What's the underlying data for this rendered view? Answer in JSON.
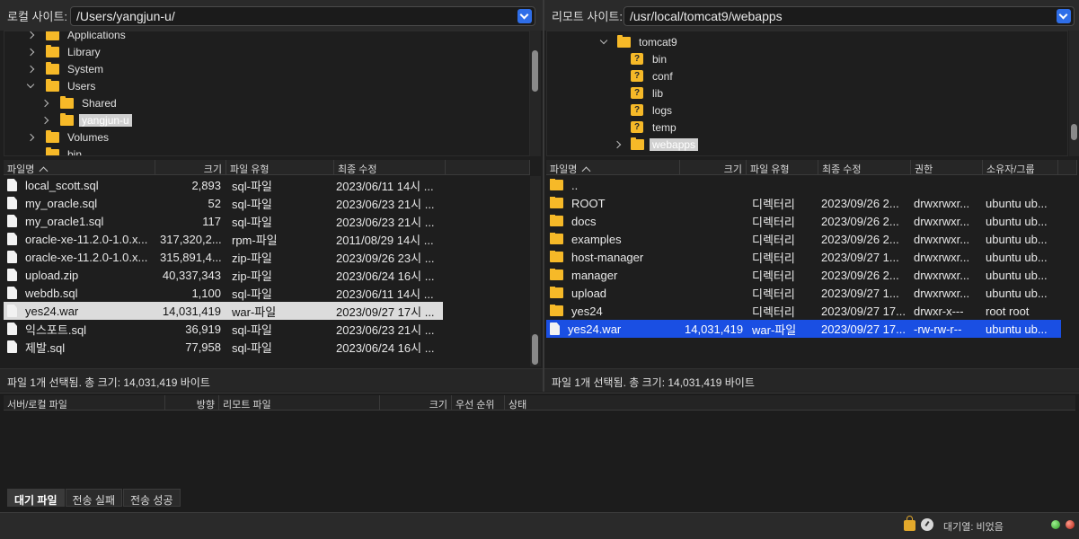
{
  "local": {
    "site_label": "로컬 사이트:",
    "path": "/Users/yangjun-u/",
    "tree": [
      {
        "label": "Applications",
        "depth": 0,
        "expand": "right"
      },
      {
        "label": "Library",
        "depth": 0,
        "expand": "right"
      },
      {
        "label": "System",
        "depth": 0,
        "expand": "right"
      },
      {
        "label": "Users",
        "depth": 0,
        "expand": "down"
      },
      {
        "label": "Shared",
        "depth": 1,
        "expand": "right"
      },
      {
        "label": "yangjun-u",
        "depth": 1,
        "expand": "right",
        "selected": true
      },
      {
        "label": "Volumes",
        "depth": 0,
        "expand": "right"
      },
      {
        "label": "bin",
        "depth": 0,
        "expand": "none"
      }
    ],
    "columns": {
      "name": "파일명",
      "size": "크기",
      "type": "파일 유형",
      "modified": "최종 수정"
    },
    "files": [
      {
        "name": "local_scott.sql",
        "size": "2,893",
        "type": "sql-파일",
        "modified": "2023/06/11 14시 ..."
      },
      {
        "name": "my_oracle.sql",
        "size": "52",
        "type": "sql-파일",
        "modified": "2023/06/23 21시 ..."
      },
      {
        "name": "my_oracle1.sql",
        "size": "117",
        "type": "sql-파일",
        "modified": "2023/06/23 21시 ..."
      },
      {
        "name": "oracle-xe-11.2.0-1.0.x...",
        "size": "317,320,2...",
        "type": "rpm-파일",
        "modified": "2011/08/29 14시 ..."
      },
      {
        "name": "oracle-xe-11.2.0-1.0.x...",
        "size": "315,891,4...",
        "type": "zip-파일",
        "modified": "2023/09/26 23시 ..."
      },
      {
        "name": "upload.zip",
        "size": "40,337,343",
        "type": "zip-파일",
        "modified": "2023/06/24 16시 ..."
      },
      {
        "name": "webdb.sql",
        "size": "1,100",
        "type": "sql-파일",
        "modified": "2023/06/11 14시 ..."
      },
      {
        "name": "yes24.war",
        "size": "14,031,419",
        "type": "war-파일",
        "modified": "2023/09/27 17시 ...",
        "selected": true
      },
      {
        "name": "익스포트.sql",
        "size": "36,919",
        "type": "sql-파일",
        "modified": "2023/06/23 21시 ..."
      },
      {
        "name": "제발.sql",
        "size": "77,958",
        "type": "sql-파일",
        "modified": "2023/06/24 16시 ..."
      }
    ],
    "status": "파일 1개 선택됨. 총 크기: 14,031,419 바이트"
  },
  "remote": {
    "site_label": "리모트 사이트:",
    "path": "/usr/local/tomcat9/webapps",
    "tree": [
      {
        "label": "tomcat9",
        "depth": 0,
        "expand": "down",
        "icon": "folder"
      },
      {
        "label": "bin",
        "depth": 1,
        "expand": "none",
        "icon": "unknown"
      },
      {
        "label": "conf",
        "depth": 1,
        "expand": "none",
        "icon": "unknown"
      },
      {
        "label": "lib",
        "depth": 1,
        "expand": "none",
        "icon": "unknown"
      },
      {
        "label": "logs",
        "depth": 1,
        "expand": "none",
        "icon": "unknown"
      },
      {
        "label": "temp",
        "depth": 1,
        "expand": "none",
        "icon": "unknown"
      },
      {
        "label": "webapps",
        "depth": 1,
        "expand": "right",
        "icon": "folder",
        "selected": true
      }
    ],
    "columns": {
      "name": "파일명",
      "size": "크기",
      "type": "파일 유형",
      "modified": "최종 수정",
      "perms": "권한",
      "owner": "소유자/그룹"
    },
    "files": [
      {
        "name": "..",
        "size": "",
        "type": "",
        "modified": "",
        "perms": "",
        "owner": "",
        "kind": "folder"
      },
      {
        "name": "ROOT",
        "size": "",
        "type": "디렉터리",
        "modified": "2023/09/26 2...",
        "perms": "drwxrwxr...",
        "owner": "ubuntu ub...",
        "kind": "folder"
      },
      {
        "name": "docs",
        "size": "",
        "type": "디렉터리",
        "modified": "2023/09/26 2...",
        "perms": "drwxrwxr...",
        "owner": "ubuntu ub...",
        "kind": "folder"
      },
      {
        "name": "examples",
        "size": "",
        "type": "디렉터리",
        "modified": "2023/09/26 2...",
        "perms": "drwxrwxr...",
        "owner": "ubuntu ub...",
        "kind": "folder"
      },
      {
        "name": "host-manager",
        "size": "",
        "type": "디렉터리",
        "modified": "2023/09/27 1...",
        "perms": "drwxrwxr...",
        "owner": "ubuntu ub...",
        "kind": "folder"
      },
      {
        "name": "manager",
        "size": "",
        "type": "디렉터리",
        "modified": "2023/09/26 2...",
        "perms": "drwxrwxr...",
        "owner": "ubuntu ub...",
        "kind": "folder"
      },
      {
        "name": "upload",
        "size": "",
        "type": "디렉터리",
        "modified": "2023/09/27 1...",
        "perms": "drwxrwxr...",
        "owner": "ubuntu ub...",
        "kind": "folder"
      },
      {
        "name": "yes24",
        "size": "",
        "type": "디렉터리",
        "modified": "2023/09/27 17...",
        "perms": "drwxr-x---",
        "owner": "root root",
        "kind": "folder"
      },
      {
        "name": "yes24.war",
        "size": "14,031,419",
        "type": "war-파일",
        "modified": "2023/09/27 17...",
        "perms": "-rw-rw-r--",
        "owner": "ubuntu ub...",
        "kind": "file",
        "selected": true
      }
    ],
    "status": "파일 1개 선택됨. 총 크기: 14,031,419 바이트"
  },
  "queue": {
    "columns": [
      "서버/로컬 파일",
      "방향",
      "리모트 파일",
      "크기",
      "우선 순위",
      "상태"
    ],
    "tabs": [
      {
        "label": "대기 파일",
        "active": true
      },
      {
        "label": "전송 실패",
        "active": false
      },
      {
        "label": "전송 성공",
        "active": false
      }
    ]
  },
  "statusbar": {
    "queue_text": "대기열: 비었음"
  },
  "colors": {
    "selection_blue": "#1a4fe3",
    "folder": "#f6b928",
    "accent": "#2f6ee8"
  }
}
